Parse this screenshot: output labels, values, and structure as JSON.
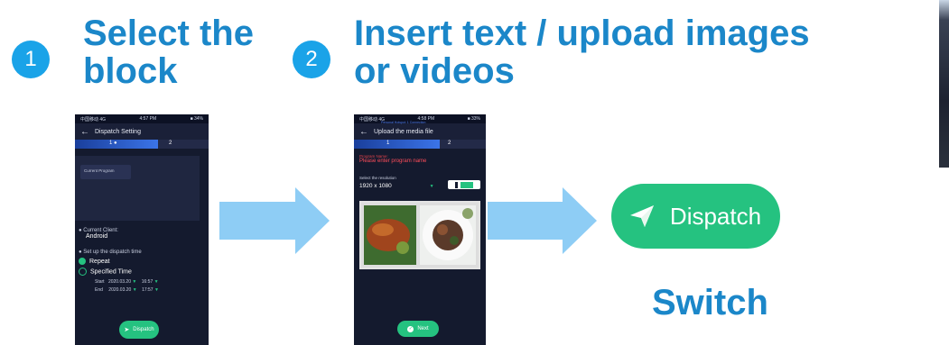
{
  "step1": {
    "number": "1",
    "title_line1": "Select the",
    "title_line2": "block"
  },
  "step2": {
    "number": "2",
    "title_line1": "Insert text / upload images",
    "title_line2": "or videos"
  },
  "phone1": {
    "status_carrier": "中国移动 4G",
    "status_time": "4:57 PM",
    "status_battery": "■ 34%",
    "header_title": "Dispatch Setting",
    "step_labels": [
      "1 ●",
      "2"
    ],
    "program_label": "Current Program",
    "client_label": "Current Client:",
    "client_value": "Android",
    "time_label": "Set up the dispatch time",
    "option_repeat": "Repeat",
    "option_specified": "Specified Time",
    "start_label": "Start",
    "start_date": "2020.03.20",
    "start_time": "16:57",
    "end_label": "End",
    "end_date": "2020.03.20",
    "end_time": "17:57",
    "dispatch_label": "Dispatch"
  },
  "phone2": {
    "status_carrier": "中国移动 4G",
    "status_time": "4:58 PM",
    "status_sub": "Personal Hotspot: 1 Connection",
    "status_battery": "■ 33%",
    "header_title": "Upload the media file",
    "step_labels": [
      "1",
      "2"
    ],
    "program_name_label": "Program Name:",
    "program_name_placeholder": "Please enter program name",
    "resolution_label": "Select the resolution",
    "resolution_value": "1920 x 1080",
    "next_label": "Next"
  },
  "dispatch_button": {
    "label": "Dispatch"
  },
  "switch_label": "Switch",
  "colors": {
    "accent_blue": "#1b87c9",
    "step_circle": "#1aa3e8",
    "green": "#25c280",
    "arrow": "#8ecdf5",
    "phone_bg": "#141a2e"
  }
}
